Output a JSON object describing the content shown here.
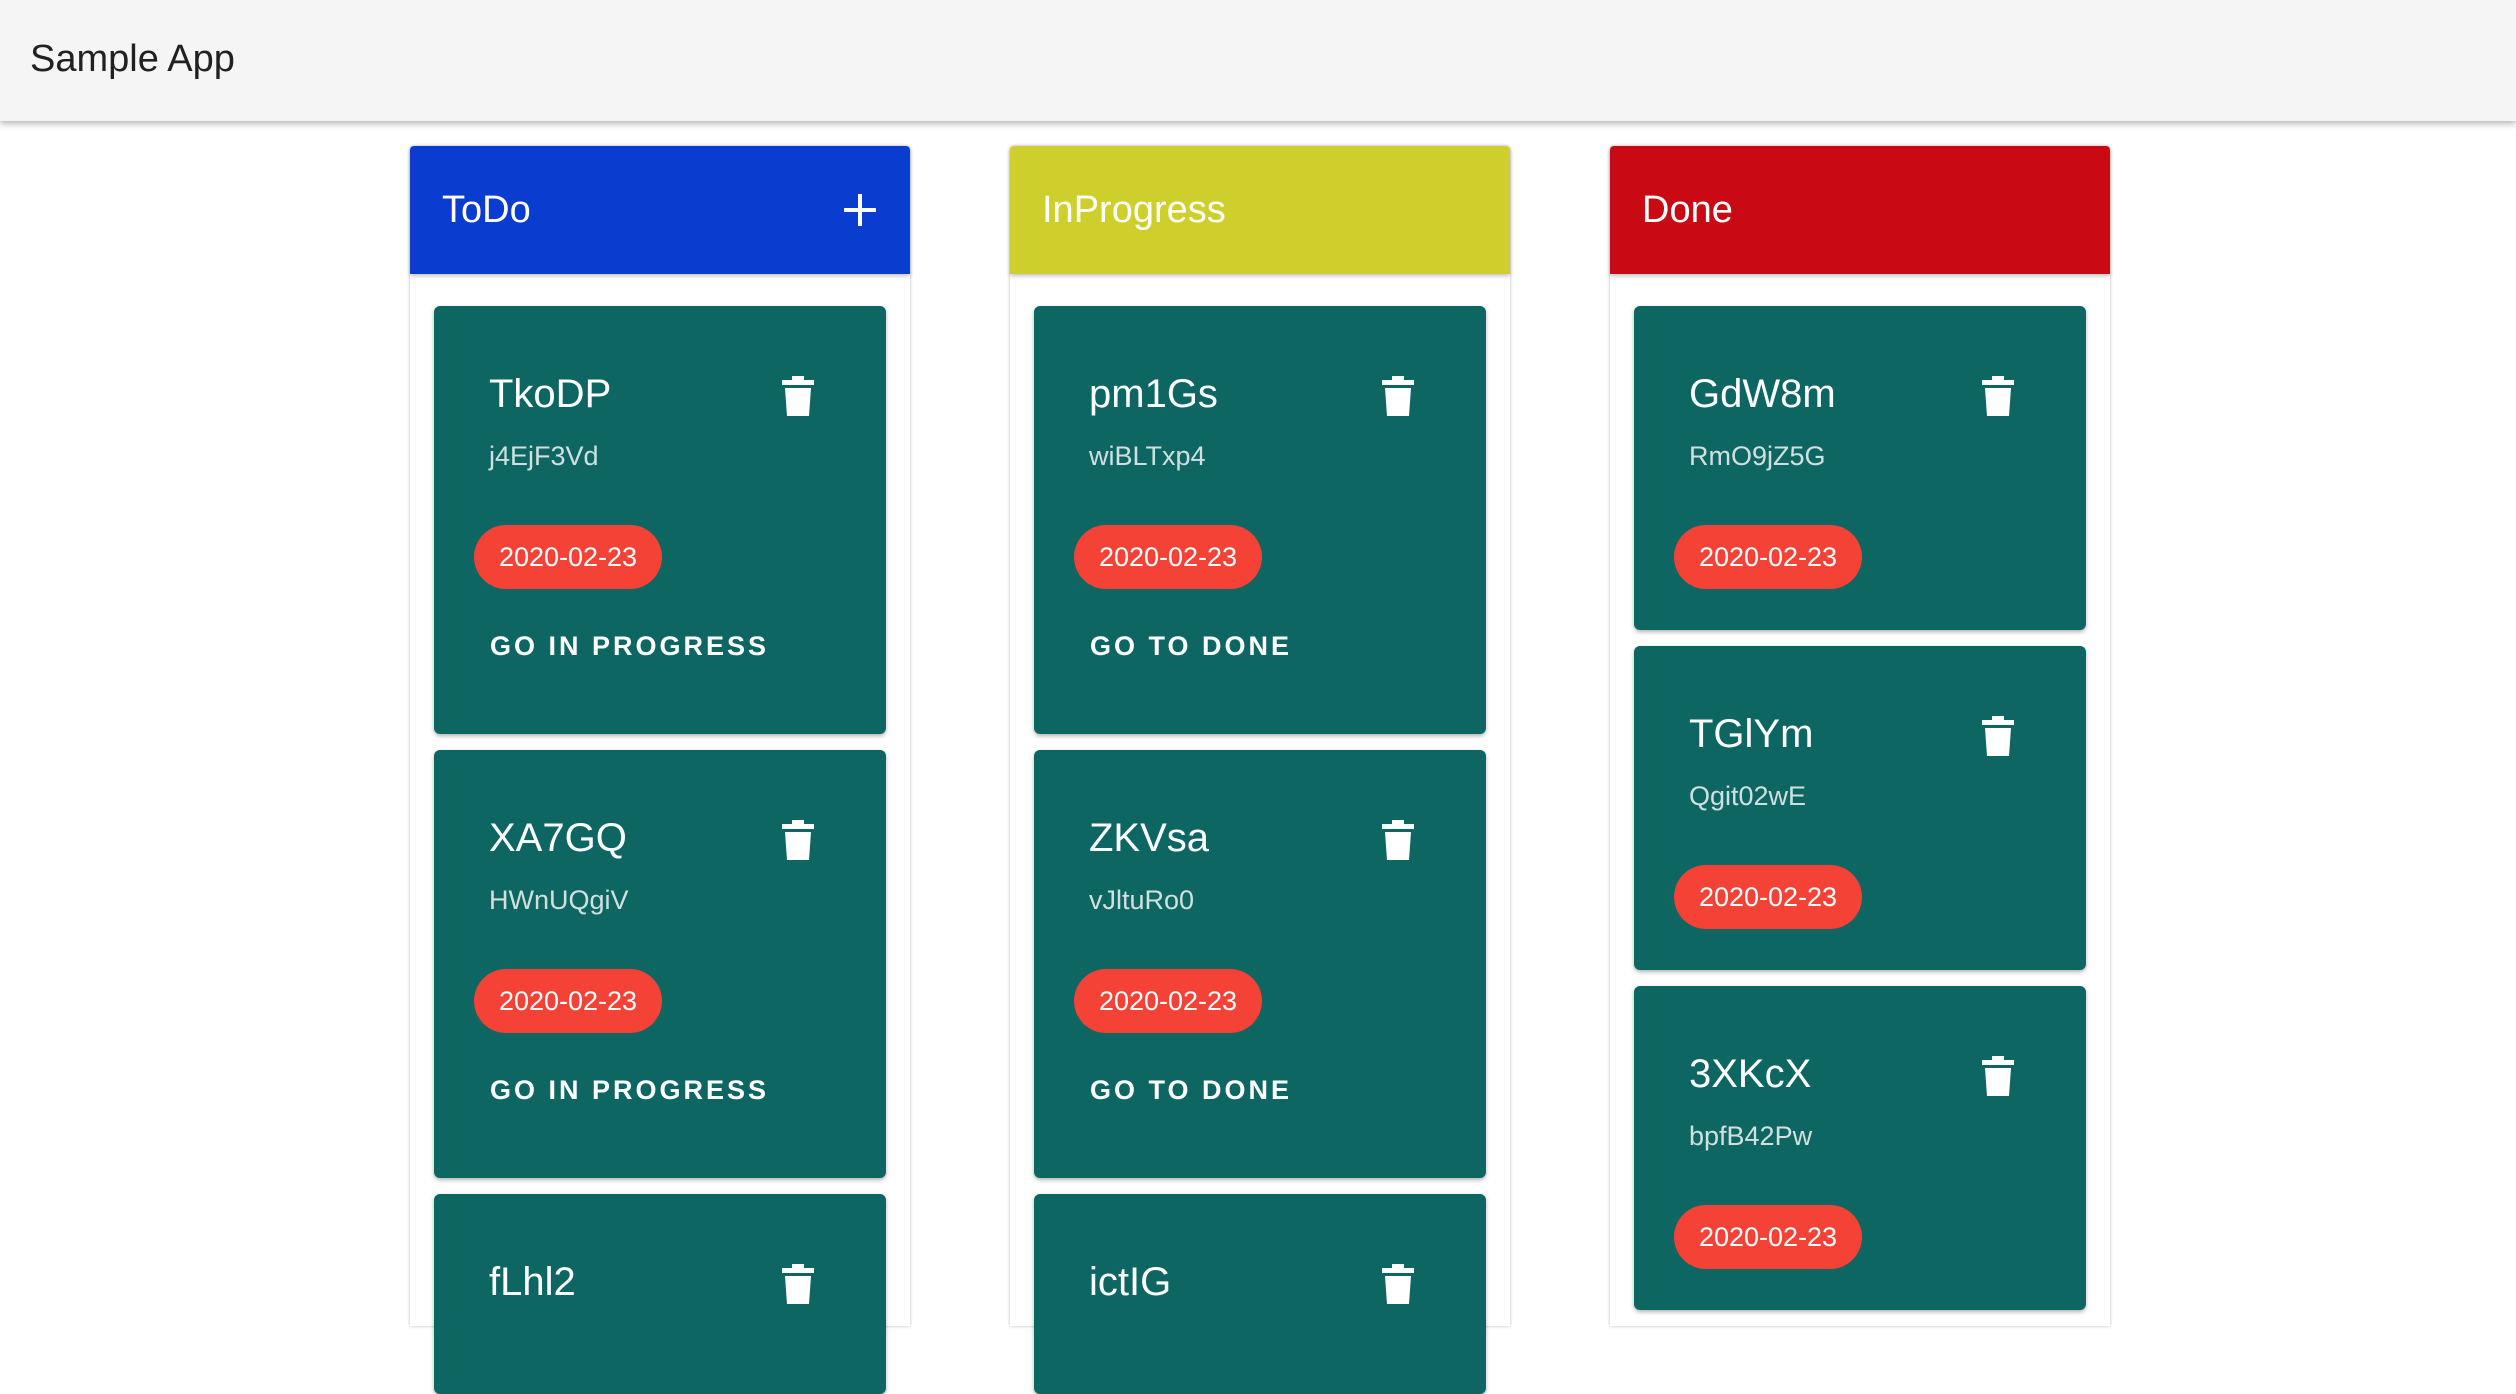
{
  "app": {
    "title": "Sample App"
  },
  "colors": {
    "card": "#0e6663",
    "chip": "#f44336",
    "todo_header": "#0a3ccf",
    "inprogress_header": "#cece2c",
    "done_header": "#c90a14"
  },
  "icons": {
    "add": "plus-icon",
    "delete": "trash-icon"
  },
  "columns": [
    {
      "title": "ToDo",
      "cards": [
        {
          "title": "TkoDP",
          "subtitle": "j4EjF3Vd",
          "date": "2020-02-23",
          "action": "GO IN PROGRESS"
        },
        {
          "title": "XA7GQ",
          "subtitle": "HWnUQgiV",
          "date": "2020-02-23",
          "action": "GO IN PROGRESS"
        },
        {
          "title": "fLhl2"
        }
      ]
    },
    {
      "title": "InProgress",
      "cards": [
        {
          "title": "pm1Gs",
          "subtitle": "wiBLTxp4",
          "date": "2020-02-23",
          "action": "GO TO DONE"
        },
        {
          "title": "ZKVsa",
          "subtitle": "vJltuRo0",
          "date": "2020-02-23",
          "action": "GO TO DONE"
        },
        {
          "title": "ictIG"
        }
      ]
    },
    {
      "title": "Done",
      "cards": [
        {
          "title": "GdW8m",
          "subtitle": "RmO9jZ5G",
          "date": "2020-02-23"
        },
        {
          "title": "TGlYm",
          "subtitle": "Qgit02wE",
          "date": "2020-02-23"
        },
        {
          "title": "3XKcX",
          "subtitle": "bpfB42Pw",
          "date": "2020-02-23"
        }
      ]
    }
  ]
}
